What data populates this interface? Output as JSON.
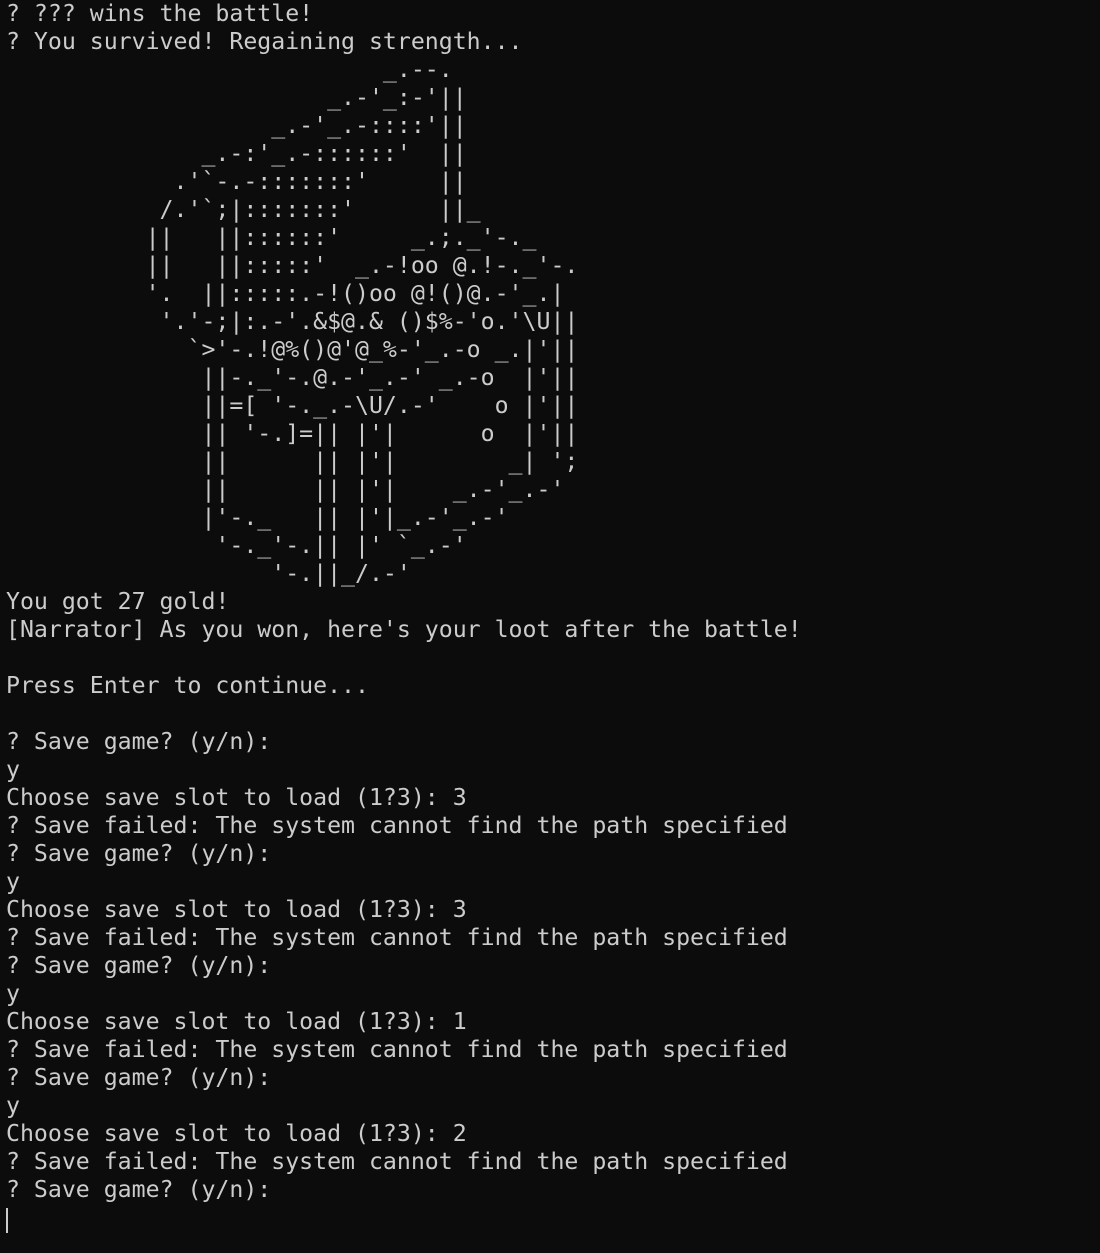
{
  "terminal": {
    "lines": [
      "? ??? wins the battle!",
      "? You survived! Regaining strength...",
      "                           _.--.",
      "                       _.-'_:-'||",
      "                   _.-'_.-::::'||",
      "              _.-:'_.-::::::'  ||",
      "            .'`-.-:::::::'     ||",
      "           /.'`;|:::::::'      ||_",
      "          ||   ||::::::'     _.;._'-._",
      "          ||   ||:::::'  _.-!oo @.!-._'-.",
      "          '.  ||:::::.-!()oo @!()@.-'_.|",
      "           '.'-;|:.-'.&$@.& ()$%-'o.'\\U||",
      "             `>'-.!@%()@'@_%-'_.-o _.|'||",
      "              ||-._'-.@.-'_.-' _.-o  |'||",
      "              ||=[ '-._.-\\U/.-'    o |'||",
      "              || '-.]=|| |'|      o  |'||",
      "              ||      || |'|        _| ';",
      "              ||      || |'|    _.-'_.-'",
      "              |'-._   || |'|_.-'_.-'",
      "               '-._'-.|| |' `_.-'",
      "                   '-.||_/.-'",
      "You got 27 gold!",
      "[Narrator] As you won, here's your loot after the battle!",
      "",
      "Press Enter to continue...",
      "",
      "? Save game? (y/n):",
      "y",
      "Choose save slot to load (1?3): 3",
      "? Save failed: The system cannot find the path specified",
      "? Save game? (y/n):",
      "y",
      "Choose save slot to load (1?3): 3",
      "? Save failed: The system cannot find the path specified",
      "? Save game? (y/n):",
      "y",
      "Choose save slot to load (1?3): 1",
      "? Save failed: The system cannot find the path specified",
      "? Save game? (y/n):",
      "y",
      "Choose save slot to load (1?3): 2",
      "? Save failed: The system cannot find the path specified",
      "? Save game? (y/n):"
    ]
  }
}
